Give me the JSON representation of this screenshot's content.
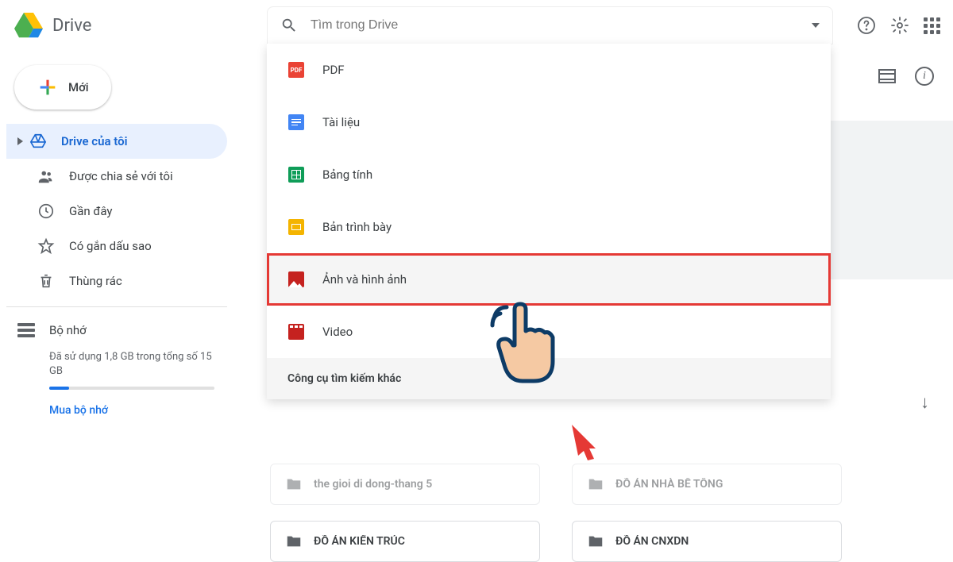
{
  "header": {
    "app_name": "Drive",
    "search_placeholder": "Tìm trong Drive"
  },
  "sidebar": {
    "new_label": "Mới",
    "items": [
      {
        "label": "Drive của tôi"
      },
      {
        "label": "Được chia sẻ với tôi"
      },
      {
        "label": "Gần đây"
      },
      {
        "label": "Có gắn dấu sao"
      },
      {
        "label": "Thùng rác"
      }
    ],
    "storage_label": "Bộ nhớ",
    "storage_text": "Đã sử dụng 1,8 GB trong tổng số 15 GB",
    "buy_label": "Mua bộ nhớ"
  },
  "search_dropdown": {
    "items": [
      {
        "label": "PDF",
        "color": "#ea4335",
        "type": "pdf"
      },
      {
        "label": "Tài liệu",
        "color": "#4285f4",
        "type": "doc"
      },
      {
        "label": "Bảng tính",
        "color": "#0f9d58",
        "type": "sheet"
      },
      {
        "label": "Bản trình bày",
        "color": "#f4b400",
        "type": "slide"
      },
      {
        "label": "Ảnh và hình ảnh",
        "color": "#c5221f",
        "type": "image"
      },
      {
        "label": "Video",
        "color": "#c5221f",
        "type": "video"
      }
    ],
    "footer": "Công cụ tìm kiếm khác"
  },
  "folders": [
    {
      "name": "the gioi di dong-thang 5"
    },
    {
      "name": "ĐỒ ÁN NHÀ BÊ TÔNG"
    },
    {
      "name": "ĐỒ ÁN KIẾN TRÚC"
    },
    {
      "name": "ĐỒ ÁN CNXDN"
    }
  ]
}
